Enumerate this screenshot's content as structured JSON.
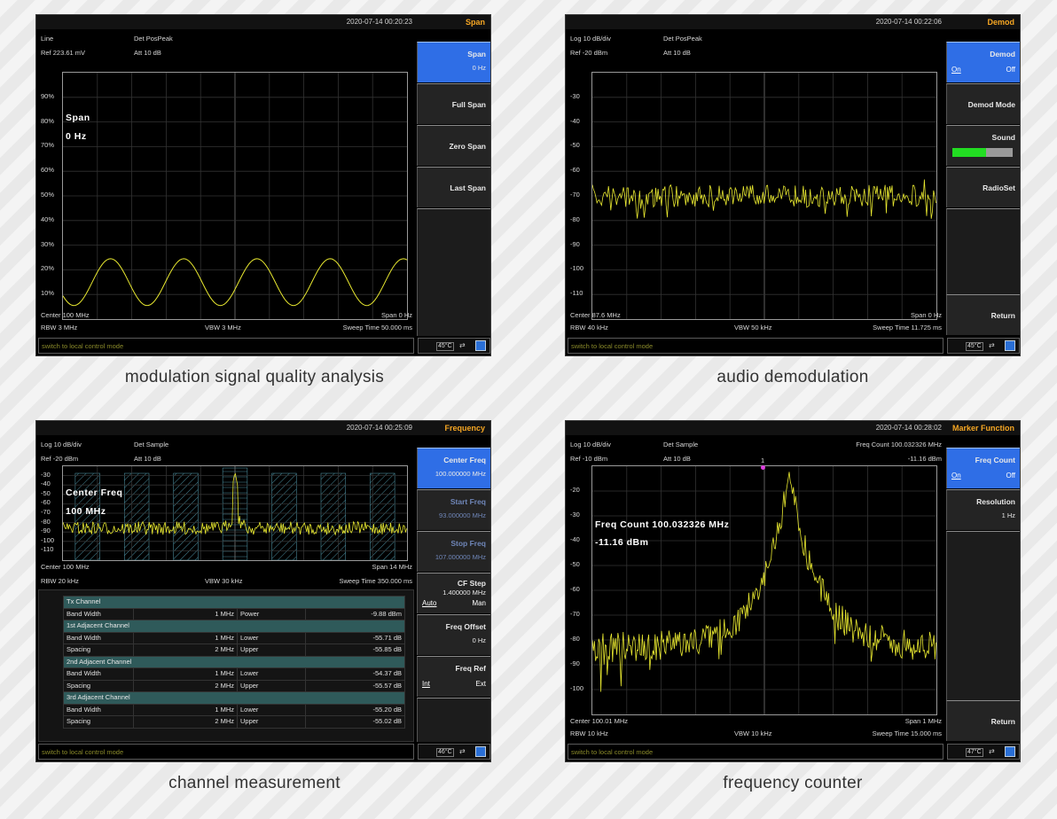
{
  "screens": [
    {
      "timestamp": "2020-07-14 00:20:23",
      "menu_title": "Span",
      "info_tl1": "Line",
      "info_tl2": "Ref 223.61 mV",
      "info_tm1": "Det PosPeak",
      "info_tm2": "Att 10 dB",
      "y_ticks": [
        "90%",
        "80%",
        "70%",
        "60%",
        "50%",
        "40%",
        "30%",
        "20%",
        "10%"
      ],
      "big_text": [
        "Span",
        "0 Hz"
      ],
      "bottom_left1": "Center 100 MHz",
      "bottom_right1": "Span 0 Hz",
      "bottom_left2": "RBW 3 MHz",
      "bottom_mid2": "VBW 3 MHz",
      "bottom_right2": "Sweep Time 50.000 ms",
      "status": "switch to local control mode",
      "temp": "45°C",
      "softkeys": [
        {
          "label": "Span",
          "value": "0 Hz"
        },
        {
          "label": "Full Span"
        },
        {
          "label": "Zero Span"
        },
        {
          "label": "Last Span"
        }
      ],
      "caption": "modulation signal quality analysis"
    },
    {
      "timestamp": "2020-07-14 00:22:06",
      "menu_title": "Demod",
      "info_tl1": "Log 10 dB/div",
      "info_tl2": "Ref -20 dBm",
      "info_tm1": "Det PosPeak",
      "info_tm2": "Att 10 dB",
      "y_ticks": [
        "-30",
        "-40",
        "-50",
        "-60",
        "-70",
        "-80",
        "-90",
        "-100",
        "-110"
      ],
      "bottom_left1": "Center 87.6 MHz",
      "bottom_right1": "Span 0 Hz",
      "bottom_left2": "RBW 40 kHz",
      "bottom_mid2": "VBW 50 kHz",
      "bottom_right2": "Sweep Time 11.725 ms",
      "status": "switch to local control mode",
      "temp": "45°C",
      "softkeys": [
        {
          "label": "Demod",
          "on": "On",
          "off": "Off"
        },
        {
          "label": "Demod Mode"
        },
        {
          "label": "Sound",
          "level": 0.5
        },
        {
          "label": "RadioSet"
        },
        {
          "label": "Return"
        }
      ],
      "caption": "audio demodulation"
    },
    {
      "timestamp": "2020-07-14 00:25:09",
      "menu_title": "Frequency",
      "info_tl1": "Log 10 dB/div",
      "info_tl2": "Ref -20 dBm",
      "info_tm1": "Det Sample",
      "info_tm2": "Att 10 dB",
      "y_ticks": [
        "-30",
        "-40",
        "-50",
        "-60",
        "-70",
        "-80",
        "-90",
        "-100",
        "-110"
      ],
      "big_text": [
        "Center Freq",
        "100 MHz"
      ],
      "bottom_left1": "Center 100 MHz",
      "bottom_right1": "Span 14 MHz",
      "bottom_left2": "RBW 20 kHz",
      "bottom_mid2": "VBW 30 kHz",
      "bottom_right2": "Sweep Time 350.000 ms",
      "status": "switch to local control mode",
      "temp": "46°C",
      "softkeys": [
        {
          "label": "Center Freq",
          "value": "100.000000 MHz"
        },
        {
          "label": "Start Freq",
          "value": "93.000000 MHz"
        },
        {
          "label": "Stop Freq",
          "value": "107.000000 MHz"
        },
        {
          "label": "CF Step",
          "value": "1.400000 MHz",
          "on": "Auto",
          "off": "Man"
        },
        {
          "label": "Freq Offset",
          "value": "0 Hz"
        },
        {
          "label": "Freq Ref",
          "on": "Int",
          "off": "Ext"
        }
      ],
      "table": [
        {
          "header": "Tx Channel"
        },
        {
          "cells": [
            "Band Width",
            "1 MHz",
            "Power",
            "-9.88 dBm"
          ]
        },
        {
          "header": "1st Adjacent Channel"
        },
        {
          "cells": [
            "Band Width",
            "1 MHz",
            "Lower",
            "-55.71 dB"
          ]
        },
        {
          "cells": [
            "Spacing",
            "2 MHz",
            "Upper",
            "-55.85 dB"
          ]
        },
        {
          "header": "2nd Adjacent Channel"
        },
        {
          "cells": [
            "Band Width",
            "1 MHz",
            "Lower",
            "-54.37 dB"
          ]
        },
        {
          "cells": [
            "Spacing",
            "2 MHz",
            "Upper",
            "-55.57 dB"
          ]
        },
        {
          "header": "3rd Adjacent Channel"
        },
        {
          "cells": [
            "Band Width",
            "1 MHz",
            "Lower",
            "-55.20 dB"
          ]
        },
        {
          "cells": [
            "Spacing",
            "2 MHz",
            "Upper",
            "-55.02 dB"
          ]
        }
      ],
      "caption": "channel measurement"
    },
    {
      "timestamp": "2020-07-14 00:28:02",
      "menu_title": "Marker Function",
      "info_tl1": "Log 10 dB/div",
      "info_tl2": "Ref -10 dBm",
      "info_tm1": "Det Sample",
      "info_tm2": "Att 10 dB",
      "info_tr1": "Freq Count  100.032326 MHz",
      "info_tr2": "-11.16 dBm",
      "y_ticks": [
        "-20",
        "-30",
        "-40",
        "-50",
        "-60",
        "-70",
        "-80",
        "-90",
        "-100"
      ],
      "big_text": [
        "Freq Count  100.032326 MHz",
        "-11.16 dBm"
      ],
      "marker_label": "1",
      "bottom_left1": "Center 100.01 MHz",
      "bottom_right1": "Span 1 MHz",
      "bottom_left2": "RBW 10 kHz",
      "bottom_mid2": "VBW 10 kHz",
      "bottom_right2": "Sweep Time 15.000 ms",
      "status": "switch to local control mode",
      "temp": "47°C",
      "softkeys": [
        {
          "label": "Freq Count",
          "on": "On",
          "off": "Off"
        },
        {
          "label": "Resolution",
          "value": "1 Hz"
        },
        {
          "label": "Return"
        }
      ],
      "caption": "frequency counter"
    }
  ],
  "colors": {
    "trace": "#e8e830",
    "softkey_active": "#2f6ee6",
    "title": "#f5a623",
    "status": "#8a8a2a"
  }
}
